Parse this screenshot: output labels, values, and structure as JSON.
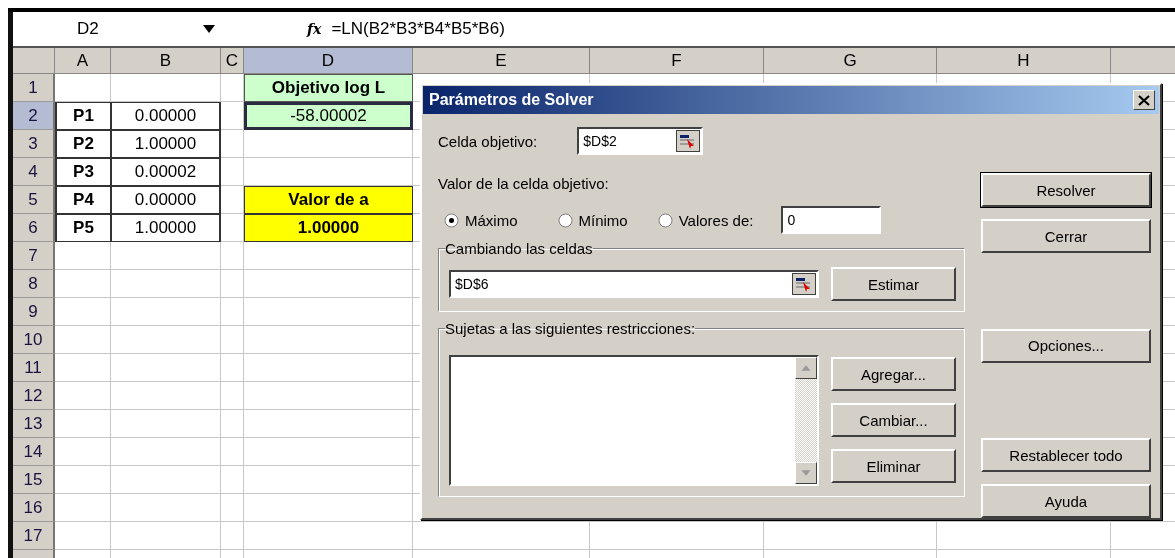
{
  "formula_bar": {
    "name_box": "D2",
    "fx_label": "fx",
    "formula": "=LN(B2*B3*B4*B5*B6)"
  },
  "sheet": {
    "columns": [
      {
        "label": "A",
        "selected": false
      },
      {
        "label": "B",
        "selected": false
      },
      {
        "label": "C",
        "selected": false
      },
      {
        "label": "D",
        "selected": true
      },
      {
        "label": "E",
        "selected": false
      },
      {
        "label": "F",
        "selected": false
      },
      {
        "label": "G",
        "selected": false
      },
      {
        "label": "H",
        "selected": false
      }
    ],
    "rows": [
      {
        "header": "1",
        "selected": false,
        "cells": [
          {},
          {},
          {},
          {
            "text": "Objetivo log L",
            "kind": "title",
            "selected": false
          }
        ]
      },
      {
        "header": "2",
        "selected": true,
        "cells": [
          {
            "text": "P1",
            "kind": "label",
            "selected": false
          },
          {
            "text": "0.00000",
            "kind": "number",
            "selected": false
          },
          {},
          {
            "text": "-58.00002",
            "kind": "result",
            "selected": true
          }
        ]
      },
      {
        "header": "3",
        "selected": false,
        "cells": [
          {
            "text": "P2",
            "kind": "label",
            "selected": false
          },
          {
            "text": "1.00000",
            "kind": "number",
            "selected": false
          }
        ]
      },
      {
        "header": "4",
        "selected": false,
        "cells": [
          {
            "text": "P3",
            "kind": "label",
            "selected": false
          },
          {
            "text": "0.00002",
            "kind": "number",
            "selected": false
          }
        ]
      },
      {
        "header": "5",
        "selected": false,
        "cells": [
          {
            "text": "P4",
            "kind": "label",
            "selected": false
          },
          {
            "text": "0.00000",
            "kind": "number",
            "selected": false
          },
          {},
          {
            "text": "Valor de a",
            "kind": "param",
            "selected": false
          }
        ]
      },
      {
        "header": "6",
        "selected": false,
        "cells": [
          {
            "text": "P5",
            "kind": "label",
            "selected": false
          },
          {
            "text": "1.00000",
            "kind": "number",
            "selected": false
          },
          {},
          {
            "text": "1.00000",
            "kind": "param",
            "selected": false
          }
        ]
      },
      {
        "header": "7",
        "selected": false
      },
      {
        "header": "8",
        "selected": false
      },
      {
        "header": "9",
        "selected": false
      },
      {
        "header": "10",
        "selected": false
      },
      {
        "header": "11",
        "selected": false
      },
      {
        "header": "12",
        "selected": false
      },
      {
        "header": "13",
        "selected": false
      },
      {
        "header": "14",
        "selected": false
      },
      {
        "header": "15",
        "selected": false
      },
      {
        "header": "16",
        "selected": false
      },
      {
        "header": "17",
        "selected": false
      }
    ]
  },
  "dialog": {
    "title": "Parámetros de Solver",
    "target_cell": {
      "label": "Celda objetivo:",
      "value": "$D$2"
    },
    "target_value": {
      "label": "Valor de la celda objetivo:",
      "options": [
        {
          "label": "Máximo",
          "selected": true
        },
        {
          "label": "Mínimo",
          "selected": false
        },
        {
          "label": "Valores de:",
          "selected": false
        }
      ],
      "value": "0"
    },
    "changing_cells": {
      "legend": "Cambiando las celdas",
      "value": "$D$6",
      "button": "Estimar"
    },
    "constraints": {
      "legend": "Sujetas a las siguientes restricciones:",
      "buttons": [
        "Agregar...",
        "Cambiar...",
        "Eliminar"
      ]
    },
    "side_buttons": [
      [
        {
          "label": "Resolver",
          "default": true
        },
        {
          "label": "Cerrar",
          "default": false
        }
      ],
      [
        {
          "label": "Opciones...",
          "default": false
        }
      ],
      [
        {
          "label": "Restablecer todo",
          "default": false
        },
        {
          "label": "Ayuda",
          "default": false
        }
      ]
    ]
  }
}
